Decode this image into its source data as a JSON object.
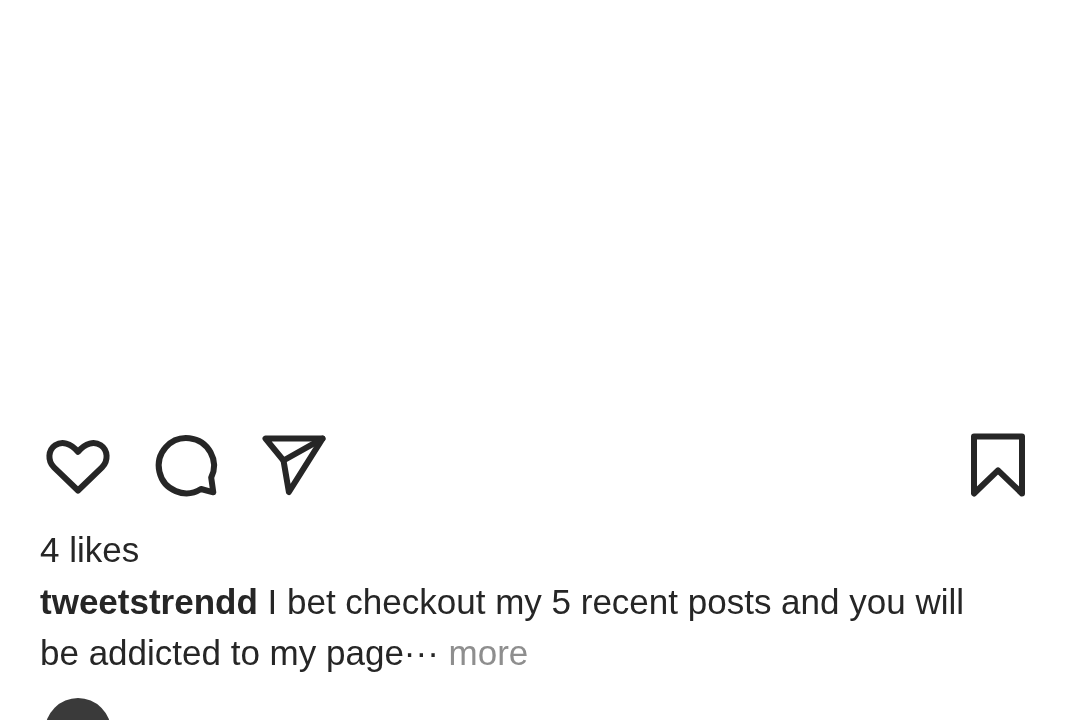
{
  "post": {
    "actions": [
      {
        "kind": "like",
        "liked": false
      },
      {
        "kind": "comment"
      },
      {
        "kind": "share"
      }
    ],
    "saved": false,
    "likes": "4 likes",
    "caption": "**tweetstrendd** I bet checkout my 5 recent posts and you will be addicted to my page···",
    "more": "more"
  }
}
